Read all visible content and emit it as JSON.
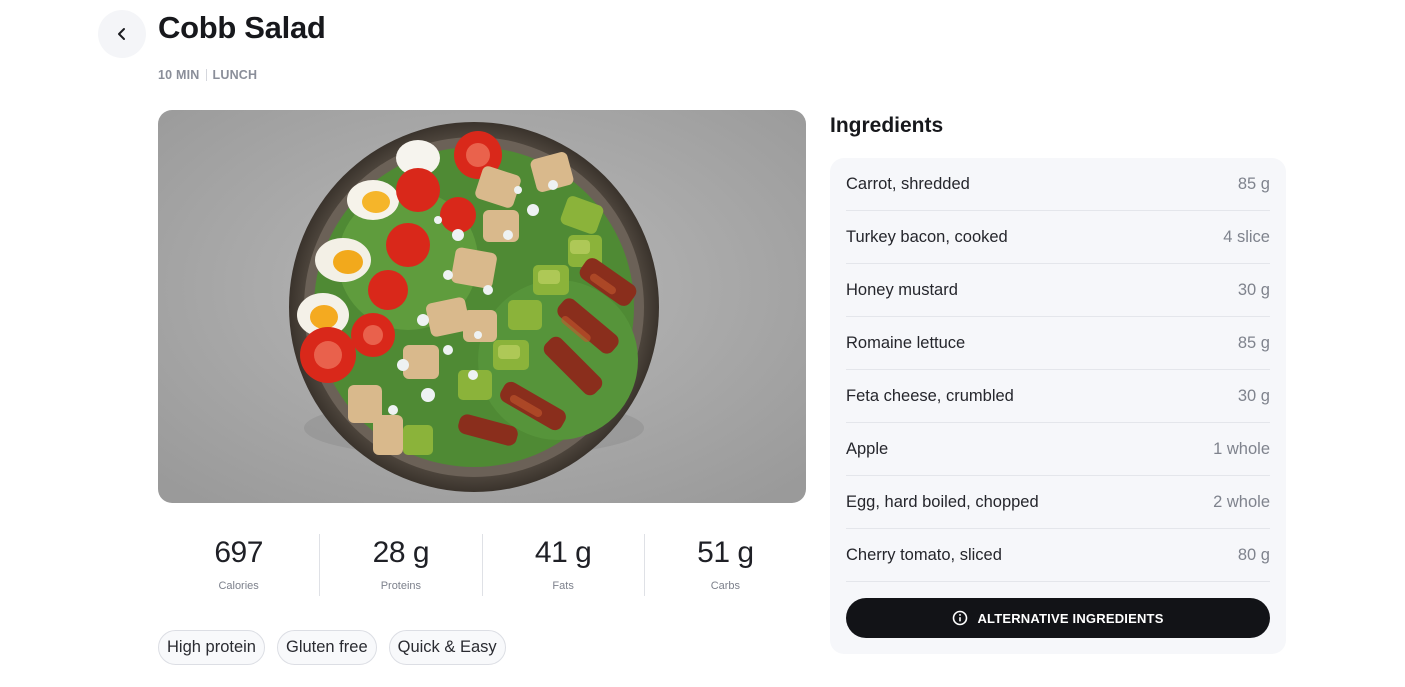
{
  "recipe": {
    "title": "Cobb Salad",
    "duration": "10 MIN",
    "meal_type": "LUNCH"
  },
  "nutrition": [
    {
      "value": "697",
      "label": "Calories"
    },
    {
      "value": "28 g",
      "label": "Proteins"
    },
    {
      "value": "41 g",
      "label": "Fats"
    },
    {
      "value": "51 g",
      "label": "Carbs"
    }
  ],
  "tags": [
    "High protein",
    "Gluten free",
    "Quick & Easy"
  ],
  "ingredients": {
    "heading": "Ingredients",
    "items": [
      {
        "name": "Carrot, shredded",
        "qty": "85 g"
      },
      {
        "name": "Turkey bacon, cooked",
        "qty": "4 slice"
      },
      {
        "name": "Honey mustard",
        "qty": "30 g"
      },
      {
        "name": "Romaine lettuce",
        "qty": "85 g"
      },
      {
        "name": "Feta cheese, crumbled",
        "qty": "30 g"
      },
      {
        "name": "Apple",
        "qty": "1 whole"
      },
      {
        "name": "Egg, hard boiled, chopped",
        "qty": "2 whole"
      },
      {
        "name": "Cherry tomato, sliced",
        "qty": "80 g"
      }
    ],
    "alt_button_label": "ALTERNATIVE INGREDIENTS"
  },
  "icons": {
    "back": "chevron-left-icon",
    "info": "info-circle-icon"
  }
}
